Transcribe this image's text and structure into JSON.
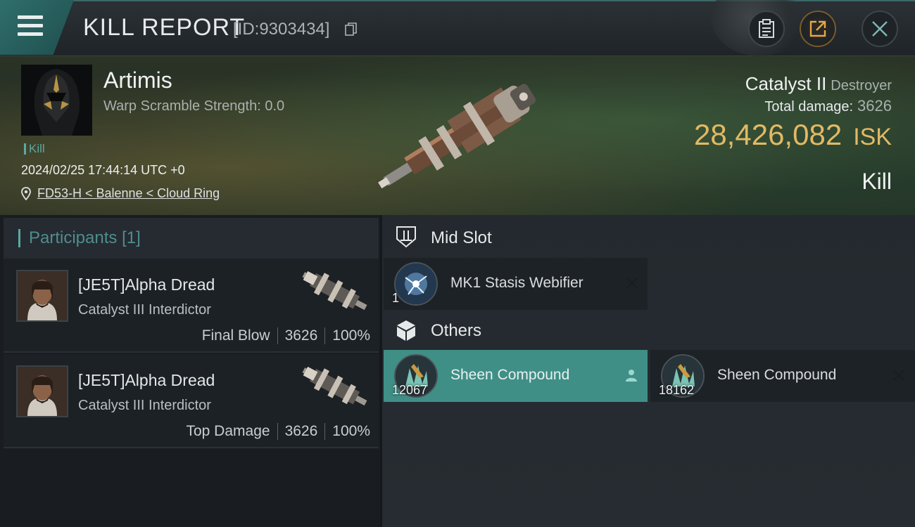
{
  "header": {
    "title": "KILL REPORT",
    "report_id": "[ID:9303434]"
  },
  "victim": {
    "name": "Artimis",
    "warp_scramble": "Warp Scramble Strength: 0.0",
    "tag": "Kill",
    "timestamp": "2024/02/25 17:44:14 UTC +0",
    "location": "FD53-H < Balenne < Cloud Ring"
  },
  "ship": {
    "name": "Catalyst II",
    "class": "Destroyer",
    "total_damage_label": "Total damage:",
    "total_damage_value": "3626",
    "isk_value": "28,426,082",
    "isk_unit": "ISK",
    "result": "Kill"
  },
  "participants": {
    "title": "Participants",
    "count": "[1]",
    "items": [
      {
        "name": "[JE5T]Alpha Dread",
        "ship": "Catalyst III Interdictor",
        "role": "Final Blow",
        "damage": "3626",
        "percent": "100%"
      },
      {
        "name": "[JE5T]Alpha Dread",
        "ship": "Catalyst III Interdictor",
        "role": "Top Damage",
        "damage": "3626",
        "percent": "100%"
      }
    ]
  },
  "fitting": {
    "mid_slot": {
      "title": "Mid Slot",
      "items": [
        {
          "name": "MK1 Stasis Webifier",
          "qty": "1"
        }
      ]
    },
    "others": {
      "title": "Others",
      "items": [
        {
          "name": "Sheen Compound",
          "qty": "12067"
        },
        {
          "name": "Sheen Compound",
          "qty": "18162"
        }
      ]
    }
  },
  "colors": {
    "accent_teal": "#5aa9a3",
    "isk_gold": "#e2b964",
    "selected_slot": "#3f8f87"
  },
  "icons": [
    "menu-icon",
    "copy-icon",
    "clipboard-icon",
    "export-icon",
    "close-icon",
    "location-pin-icon",
    "mid-slot-icon",
    "cube-icon",
    "person-icon",
    "x-icon"
  ]
}
